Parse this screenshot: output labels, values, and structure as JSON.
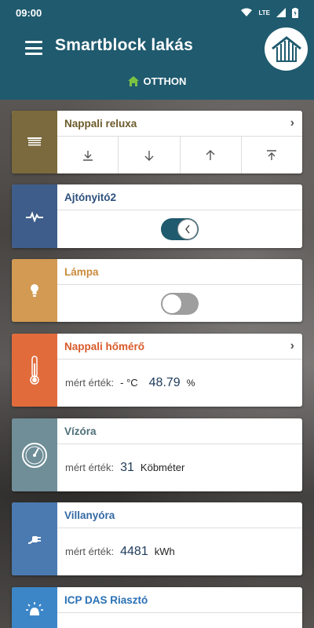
{
  "status": {
    "time": "09:00",
    "network": "LTE"
  },
  "app": {
    "title": "Smartblock lakás",
    "breadcrumb": "OTTHON"
  },
  "colors": {
    "appbar": "#1f5a6e",
    "blinds": "#7a6a3d",
    "door": "#3e5d8a",
    "lamp": "#d29a52",
    "thermo": "#e26b3c",
    "water": "#6f8e97",
    "power": "#4a7ab0",
    "alarm": "#3c86c8"
  },
  "cards": {
    "blinds": {
      "name": "Nappali reluxa",
      "icon": "blinds-icon"
    },
    "door": {
      "name": "Ajtónyitó2",
      "icon": "pulse-icon",
      "state": "on"
    },
    "lamp": {
      "name": "Lámpa",
      "icon": "bulb-icon",
      "state": "off"
    },
    "thermo": {
      "name": "Nappali hőmérő",
      "icon": "thermometer-icon",
      "label": "mért érték:",
      "temp": "- °C",
      "humidity": "48.79",
      "humidity_unit": "%"
    },
    "water": {
      "name": "Vízóra",
      "icon": "gauge-icon",
      "label": "mért érték:",
      "value": "31",
      "unit": "Köbméter"
    },
    "power": {
      "name": "Villanyóra",
      "icon": "plug-icon",
      "label": "mért érték:",
      "value": "4481",
      "unit": "kWh"
    },
    "alarm": {
      "name": "ICP DAS Riasztó",
      "icon": "alarm-icon"
    }
  }
}
